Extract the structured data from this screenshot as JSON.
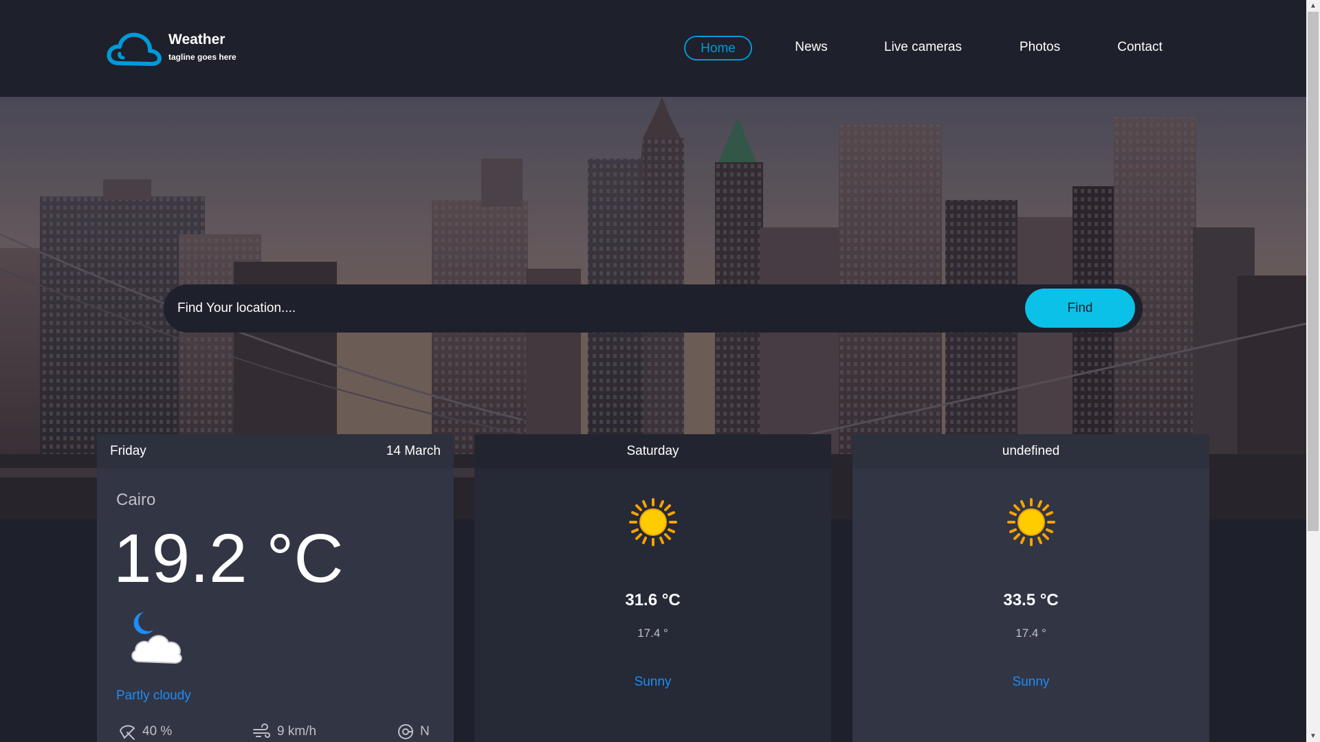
{
  "brand": {
    "title": "Weather",
    "tagline": "tagline goes here",
    "icon": "cloud-icon"
  },
  "nav": {
    "items": [
      {
        "label": "Home",
        "active": true
      },
      {
        "label": "News",
        "active": false
      },
      {
        "label": "Live cameras",
        "active": false
      },
      {
        "label": "Photos",
        "active": false
      },
      {
        "label": "Contact",
        "active": false
      }
    ]
  },
  "search": {
    "placeholder": "Find Your location....",
    "value": "",
    "button_label": "Find"
  },
  "today": {
    "day": "Friday",
    "date": "14 March",
    "city": "Cairo",
    "temperature": "19.2 °C",
    "icon": "partly-cloudy-night-icon",
    "condition": "Partly cloudy",
    "humidity": "40 %",
    "wind_speed": "9 km/h",
    "wind_direction": "N"
  },
  "forecast": [
    {
      "day": "Saturday",
      "icon": "sun-icon",
      "max_temp": "31.6 °C",
      "min_temp": "17.4 °",
      "condition": "Sunny"
    },
    {
      "day": "undefined",
      "icon": "sun-icon",
      "max_temp": "33.5 °C",
      "min_temp": "17.4 °",
      "condition": "Sunny"
    }
  ],
  "colors": {
    "background": "#1e202b",
    "accent": "#009ad8",
    "find_button": "#0bc1e8",
    "condition_text": "#1f8cf5",
    "card": "#323544",
    "card_alt": "#262936"
  }
}
